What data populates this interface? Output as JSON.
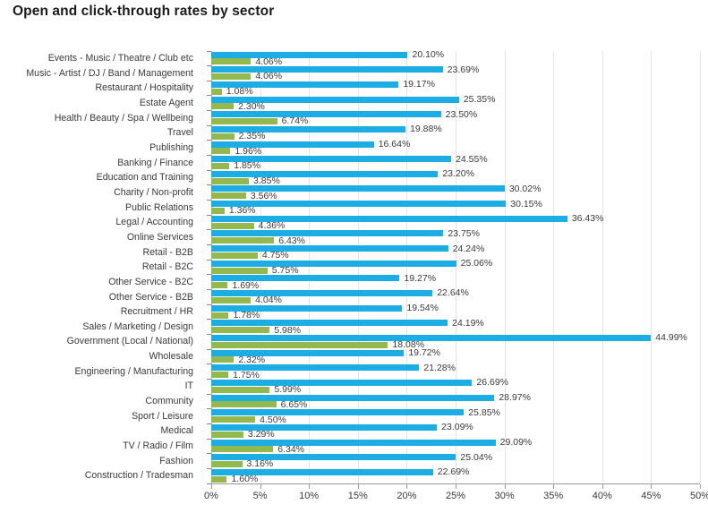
{
  "chart_data": {
    "type": "bar",
    "orientation": "horizontal",
    "title": "Open and click-through rates by sector",
    "xlabel": "",
    "ylabel": "",
    "xlim": [
      0,
      50
    ],
    "xticks": [
      "0%",
      "5%",
      "10%",
      "15%",
      "20%",
      "25%",
      "30%",
      "35%",
      "40%",
      "45%",
      "50%"
    ],
    "xtick_values": [
      0,
      5,
      10,
      15,
      20,
      25,
      30,
      35,
      40,
      45,
      50
    ],
    "grid": true,
    "legend": "none",
    "value_suffix": "%",
    "colors": {
      "open_rate": "#1DADE5",
      "click_rate": "#93B84D",
      "gridline": "#e4e4e4",
      "axis": "#9a9a9a",
      "text": "#3a3a3a",
      "title": "#1a1a1a",
      "background": "#ffffff"
    },
    "categories": [
      "Events - Music / Theatre / Club etc",
      "Music - Artist / DJ / Band / Management",
      "Restaurant / Hospitality",
      "Estate Agent",
      "Health / Beauty / Spa / Wellbeing",
      "Travel",
      "Publishing",
      "Banking / Finance",
      "Education and Training",
      "Charity / Non-profit",
      "Public Relations",
      "Legal / Accounting",
      "Online Services",
      "Retail - B2B",
      "Retail - B2C",
      "Other Service - B2C",
      "Other Service - B2B",
      "Recruitment / HR",
      "Sales / Marketing / Design",
      "Government (Local / National)",
      "Wholesale",
      "Engineering / Manufacturing",
      "IT",
      "Community",
      "Sport / Leisure",
      "Medical",
      "TV / Radio / Film",
      "Fashion",
      "Construction / Tradesman"
    ],
    "series": [
      {
        "name": "Open rate",
        "color": "#1DADE5",
        "values": [
          20.1,
          23.69,
          19.17,
          25.35,
          23.5,
          19.88,
          16.64,
          24.55,
          23.2,
          30.02,
          30.15,
          36.43,
          23.75,
          24.24,
          25.06,
          19.27,
          22.64,
          19.54,
          24.19,
          44.99,
          19.72,
          21.28,
          26.69,
          28.97,
          25.85,
          23.09,
          29.09,
          25.04,
          22.69
        ],
        "labels": [
          "20.10%",
          "23.69%",
          "19.17%",
          "25.35%",
          "23.50%",
          "19.88%",
          "16.64%",
          "24.55%",
          "23.20%",
          "30.02%",
          "30.15%",
          "36.43%",
          "23.75%",
          "24.24%",
          "25.06%",
          "19.27%",
          "22.64%",
          "19.54%",
          "24.19%",
          "44.99%",
          "19.72%",
          "21.28%",
          "26.69%",
          "28.97%",
          "25.85%",
          "23.09%",
          "29.09%",
          "25.04%",
          "22.69%"
        ]
      },
      {
        "name": "Click-through rate",
        "color": "#93B84D",
        "values": [
          4.06,
          4.06,
          1.08,
          2.3,
          6.74,
          2.35,
          1.96,
          1.85,
          3.85,
          3.56,
          1.36,
          4.36,
          6.43,
          4.75,
          5.75,
          1.69,
          4.04,
          1.78,
          5.98,
          18.08,
          2.32,
          1.75,
          5.99,
          6.65,
          4.5,
          3.29,
          6.34,
          3.16,
          1.6
        ],
        "labels": [
          "4.06%",
          "4.06%",
          "1.08%",
          "2.30%",
          "6.74%",
          "2.35%",
          "1.96%",
          "1.85%",
          "3.85%",
          "3.56%",
          "1.36%",
          "4.36%",
          "6.43%",
          "4.75%",
          "5.75%",
          "1.69%",
          "4.04%",
          "1.78%",
          "5.98%",
          "18.08%",
          "2.32%",
          "1.75%",
          "5.99%",
          "6.65%",
          "4.50%",
          "3.29%",
          "6.34%",
          "3.16%",
          "1.60%"
        ]
      }
    ]
  }
}
